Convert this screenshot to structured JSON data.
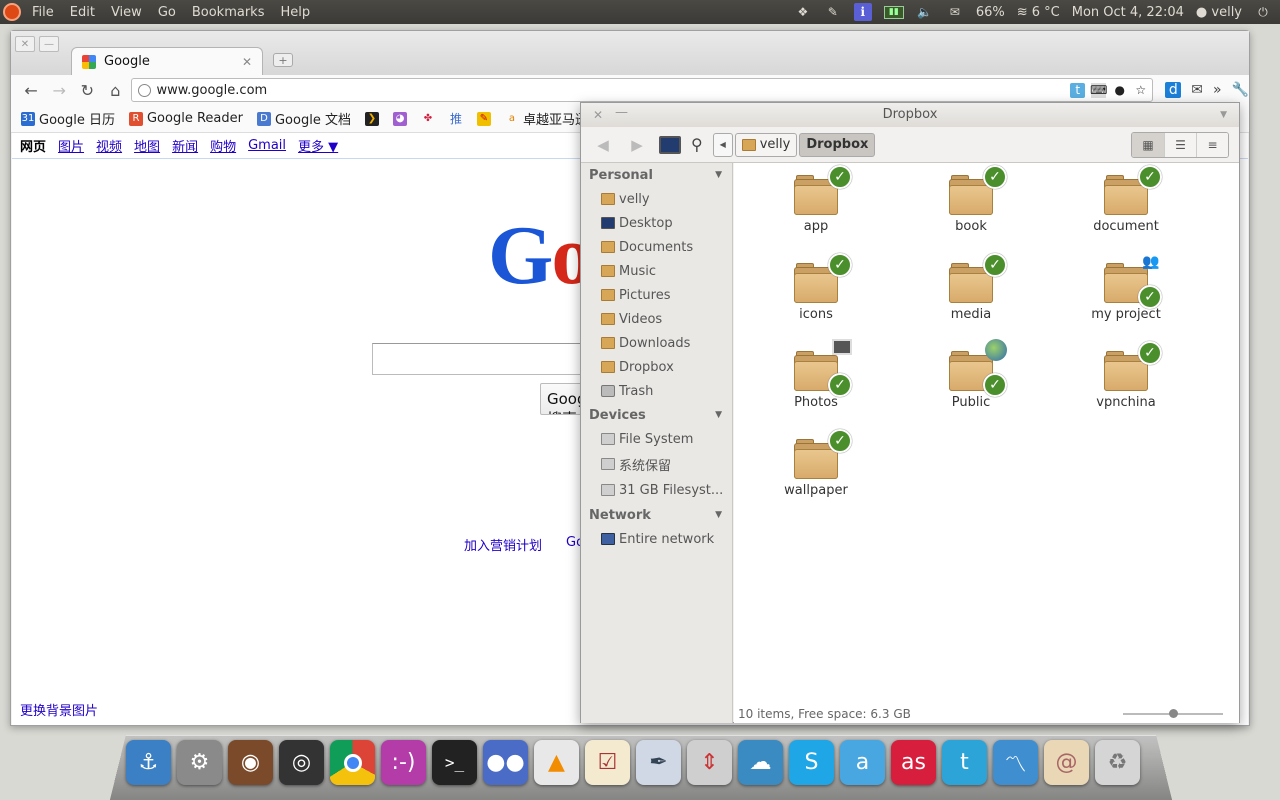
{
  "top_panel": {
    "menus": [
      "File",
      "Edit",
      "View",
      "Go",
      "Bookmarks",
      "Help"
    ],
    "battery": "66%",
    "weather": "6 °C",
    "clock": "Mon Oct 4, 22:04",
    "user": "velly"
  },
  "browser": {
    "tab_title": "Google",
    "url": "www.google.com",
    "bookmarks": [
      "Google 日历",
      "Google Reader",
      "Google 文档",
      "推",
      "卓越亚马逊"
    ],
    "gbar": [
      "网页",
      "图片",
      "视频",
      "地图",
      "新闻",
      "购物",
      "Gmail",
      "更多 ▼"
    ],
    "logo_part1": "G",
    "logo_part2": "o",
    "search_button": "Google 搜索",
    "ad_link": "加入营销计划",
    "ad_link2": "Go",
    "bg_link": "更换背景图片"
  },
  "file_manager": {
    "title": "Dropbox",
    "crumbs": [
      "velly",
      "Dropbox"
    ],
    "sidebar": {
      "personal_header": "Personal",
      "personal": [
        "velly",
        "Desktop",
        "Documents",
        "Music",
        "Pictures",
        "Videos",
        "Downloads",
        "Dropbox",
        "Trash"
      ],
      "devices_header": "Devices",
      "devices": [
        "File System",
        "系统保留",
        "31 GB Filesyst..."
      ],
      "network_header": "Network",
      "network": [
        "Entire network"
      ]
    },
    "files": [
      "app",
      "book",
      "document",
      "icons",
      "media",
      "my project",
      "Photos",
      "Public",
      "vpnchina",
      "wallpaper"
    ],
    "status": "10 items, Free space: 6.3 GB"
  },
  "colors": {
    "ubuntu_orange": "#dd4814",
    "link_blue": "#2000c8",
    "dropbox_check": "#4a8f2c"
  }
}
